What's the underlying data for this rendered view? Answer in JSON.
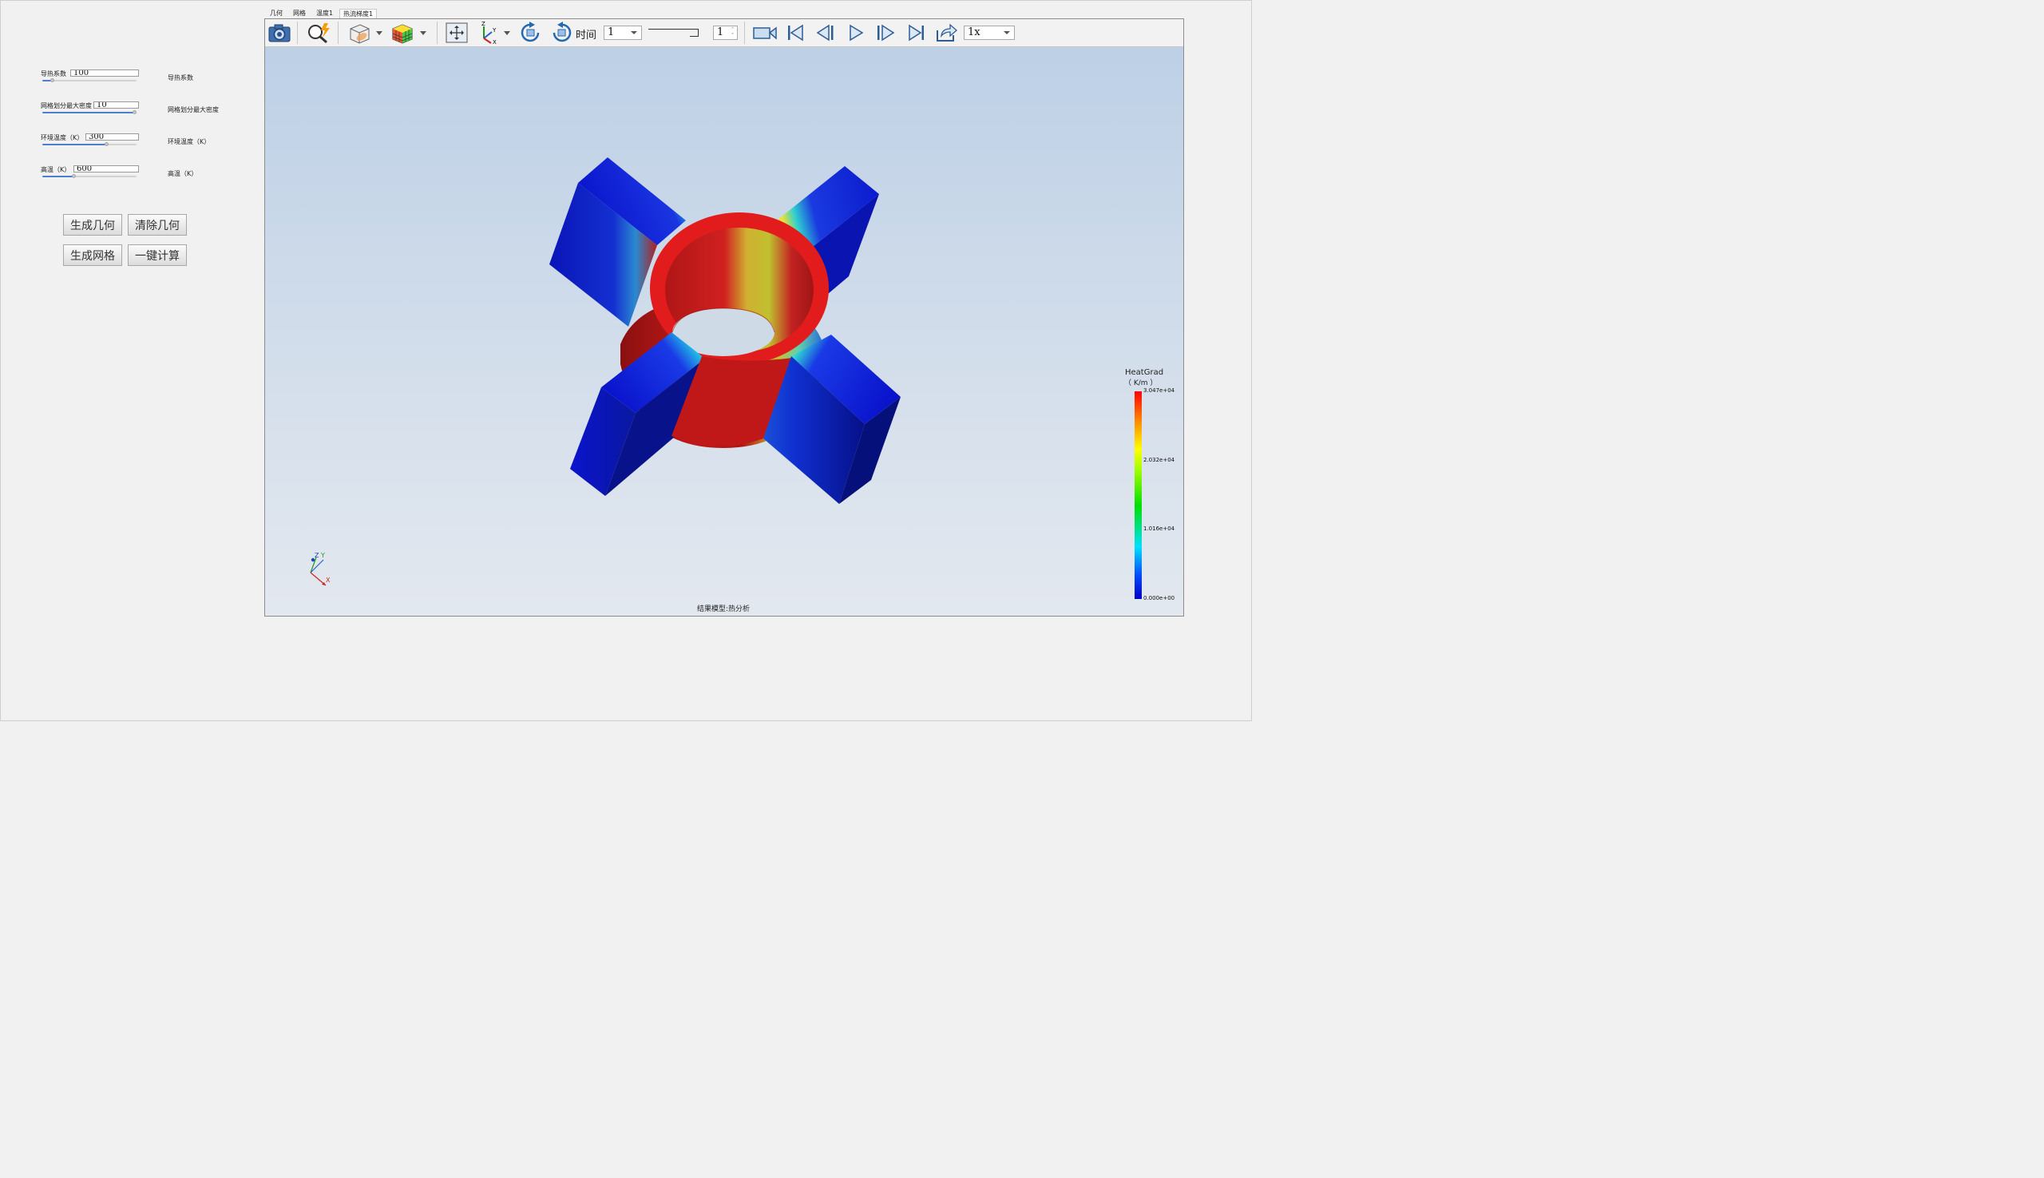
{
  "tabs": [
    "几何",
    "网格",
    "温度1",
    "热流梯度1"
  ],
  "params": [
    {
      "label": "导热系数",
      "value": "100",
      "echo": "导热系数",
      "fill": 0.1
    },
    {
      "label": "网格划分最大密度",
      "value": "10",
      "echo": "网格划分最大密度",
      "fill": 0.96
    },
    {
      "label": "环境温度（K）",
      "value": "300",
      "echo": "环境温度（K）",
      "fill": 0.68
    },
    {
      "label": "高温（K）",
      "value": "600",
      "echo": "高温（K）",
      "fill": 0.33
    }
  ],
  "buttons": {
    "gen_geometry": "生成几何",
    "clear_geometry": "清除几何",
    "gen_mesh": "生成网格",
    "one_click_compute": "一键计算"
  },
  "toolbar": {
    "time_label": "时间",
    "time_value": "1",
    "step_value": "1",
    "speed_value": "1x"
  },
  "viewer": {
    "caption": "结果模型:热分析"
  },
  "colorbar": {
    "title": "HeatGrad",
    "unit": "（ K/m ）",
    "ticks": [
      "3.047e+04",
      "2.032e+04",
      "1.016e+04",
      "0.000e+00"
    ]
  },
  "colors": {
    "hot": "#cc1111",
    "cold": "#0a14cc",
    "accent": "#4d7fd0"
  }
}
